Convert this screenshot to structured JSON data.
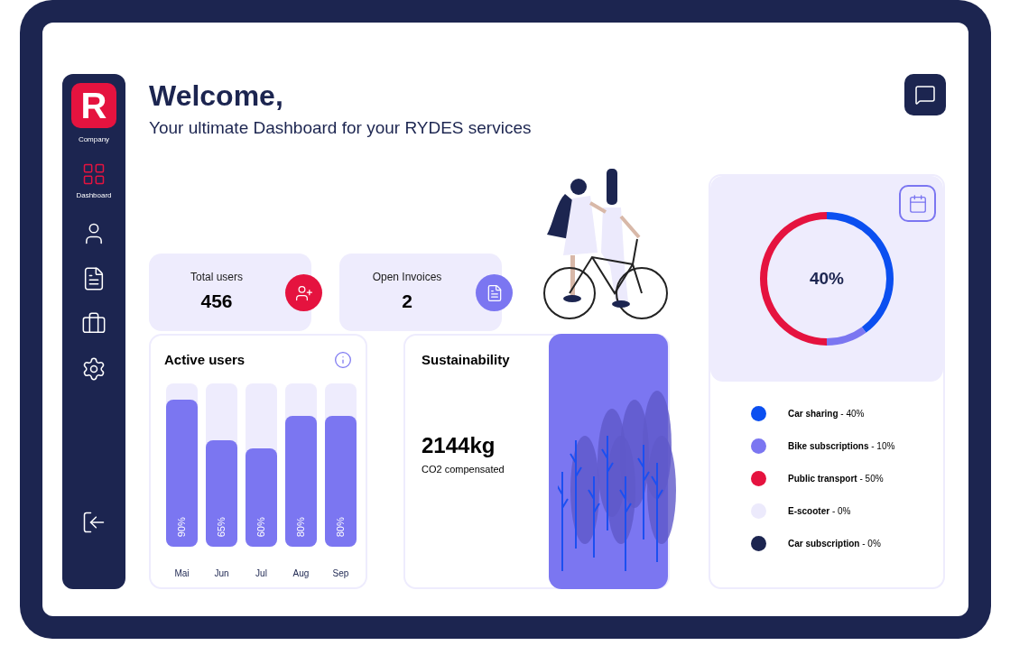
{
  "sidebar": {
    "logo": {
      "letter": "R",
      "label": "Company"
    },
    "items": [
      {
        "label": "Dashboard",
        "selected": true
      },
      {
        "selected": false
      },
      {
        "selected": false
      },
      {
        "selected": false
      },
      {
        "selected": false
      }
    ]
  },
  "header": {
    "title": "Welcome,",
    "subtitle": "Your ultimate Dashboard for your RYDES services"
  },
  "stats": [
    {
      "label": "Total users",
      "value": "456",
      "color": "#e5133f",
      "kind": "users"
    },
    {
      "label": "Open Invoices",
      "value": "2",
      "color": "#7b76f1",
      "kind": "invoices"
    }
  ],
  "active_users": {
    "title": "Active users",
    "bars": [
      {
        "month": "Mai",
        "level": 0.9,
        "reading": "90%"
      },
      {
        "month": "Jun",
        "level": 0.65,
        "reading": "65%"
      },
      {
        "month": "Jul",
        "level": 0.6,
        "reading": "60%"
      },
      {
        "month": "Aug",
        "level": 0.8,
        "reading": "80%"
      },
      {
        "month": "Sep",
        "level": 0.8,
        "reading": "80%"
      }
    ]
  },
  "sustainability": {
    "title": "Sustainability",
    "value": "2144kg",
    "caption": "CO2 compensated"
  },
  "usage": {
    "center_label": "40%",
    "chart_data": {
      "type": "donut",
      "categories": [
        "Car sharing",
        "Bike subscriptions",
        "Public transport",
        "E-scooter",
        "Car subscription"
      ],
      "values": [
        40,
        10,
        50,
        0,
        0
      ]
    },
    "legend": [
      {
        "value": "- 40%",
        "color": "#0b4ff0"
      },
      {
        "value": "- 10%",
        "color": "#7b76f1"
      },
      {
        "value": "- 50%",
        "color": "#e5133f"
      },
      {
        "value": "- 0%",
        "color": "#eceafc"
      },
      {
        "value": "- 0%",
        "color": "#1c2550"
      }
    ]
  }
}
